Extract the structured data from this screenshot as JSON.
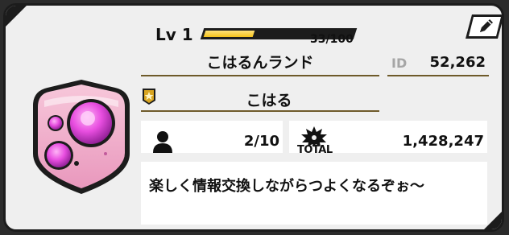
{
  "profile": {
    "level_label": "Lv 1",
    "xp": {
      "current": 33,
      "max": 100,
      "text": "33/100",
      "fill_fraction": 0.33
    },
    "player_name": "こはるんランド",
    "id_label": "ID",
    "id_value": "52,262",
    "title": "こはる",
    "friends": "2/10",
    "total_label": "TOTAL",
    "total_value": "1,428,247",
    "comment": "楽しく情報交換しながらつよくなるぞぉ〜"
  },
  "icons": {
    "emblem": "pink-shield-emblem-icon",
    "rank": "gold-star-rank-icon",
    "friends": "person-icon",
    "total": "burst-icon",
    "edit": "pencil-icon"
  },
  "colors": {
    "xp_fill": "#f5c21a",
    "divider": "#6e5a2a",
    "emblem_pink": "#f0a8c8",
    "emblem_magenta": "#e040d8"
  }
}
